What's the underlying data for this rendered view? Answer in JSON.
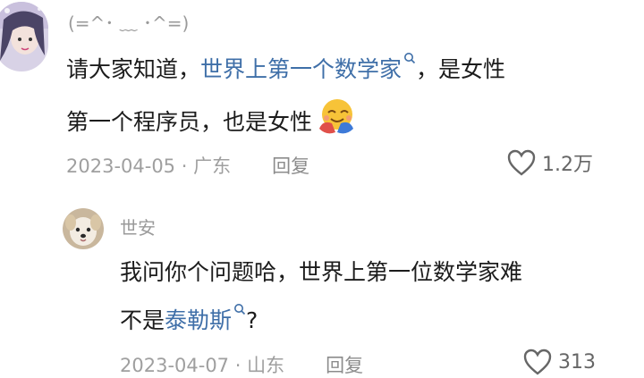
{
  "comment": {
    "username": "(=^･ ﹏ ･^=)",
    "line1_before": "请大家知道，",
    "line1_link": "世界上第一个数学家",
    "line1_after": "，是女性",
    "line2": "第一个程序员，也是女性",
    "emoji": "hugging-face",
    "date": "2023-04-05",
    "dot": "·",
    "location": "广东",
    "reply_label": "回复",
    "like_count": "1.2万"
  },
  "reply": {
    "username": "世安",
    "line1": "我问你个问题哈，世界上第一位数学家难",
    "line2_before": "不是",
    "line2_link": "泰勒斯",
    "line2_after": "?",
    "date": "2023-04-07",
    "dot": "·",
    "location": "山东",
    "reply_label": "回复",
    "like_count": "313"
  },
  "colors": {
    "link": "#3f6fa8",
    "meta": "#9f9f9f"
  }
}
